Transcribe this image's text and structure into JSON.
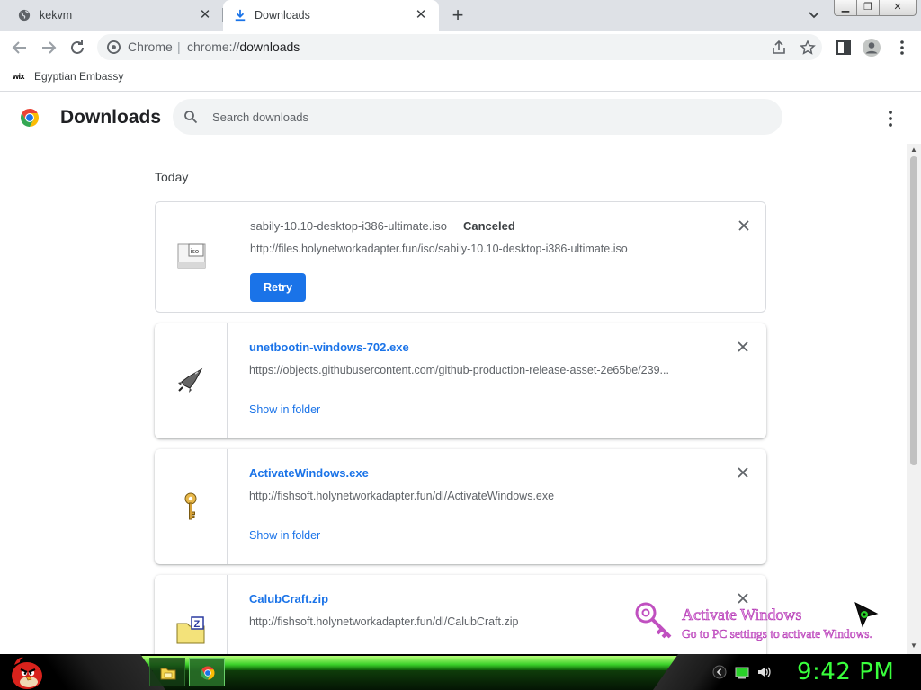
{
  "browser": {
    "tabs": [
      {
        "title": "kekvm",
        "icon": "globe-icon"
      },
      {
        "title": "Downloads",
        "icon": "download-icon",
        "active": true
      }
    ],
    "window_controls": [
      "minimize",
      "restore",
      "close"
    ],
    "omnibox": {
      "chip": "Chrome",
      "divider": "|",
      "url_scheme": "chrome://",
      "url_path": "downloads"
    },
    "bookmarks": [
      {
        "favicon": "wix",
        "label": "Egyptian Embassy"
      }
    ]
  },
  "downloads_page": {
    "title": "Downloads",
    "search_placeholder": "Search downloads",
    "section_date": "Today",
    "items": [
      {
        "filename": "sabily-10.10-desktop-i386-ultimate.iso",
        "status": "Canceled",
        "url": "http://files.holynetworkadapter.fun/iso/sabily-10.10-desktop-i386-ultimate.iso",
        "action": "Retry",
        "icon": "iso-file-icon"
      },
      {
        "filename": "unetbootin-windows-702.exe",
        "status": "",
        "url": "https://objects.githubusercontent.com/github-production-release-asset-2e65be/239...",
        "action": "Show in folder",
        "icon": "rocket-app-icon"
      },
      {
        "filename": "ActivateWindows.exe",
        "status": "",
        "url": "http://fishsoft.holynetworkadapter.fun/dl/ActivateWindows.exe",
        "action": "Show in folder",
        "icon": "key-app-icon"
      },
      {
        "filename": "CalubCraft.zip",
        "status": "",
        "url": "http://fishsoft.holynetworkadapter.fun/dl/CalubCraft.zip",
        "action": "",
        "icon": "zip-folder-icon"
      }
    ]
  },
  "watermark": {
    "line1": "Activate Windows",
    "line2": "Go to PC settings to activate Windows."
  },
  "taskbar": {
    "clock": "9:42 PM",
    "apps": [
      "file-explorer-icon",
      "chrome-icon"
    ],
    "tray": [
      "chevron-left-icon",
      "battery-icon",
      "volume-icon"
    ],
    "accent": "#39ff3c"
  }
}
